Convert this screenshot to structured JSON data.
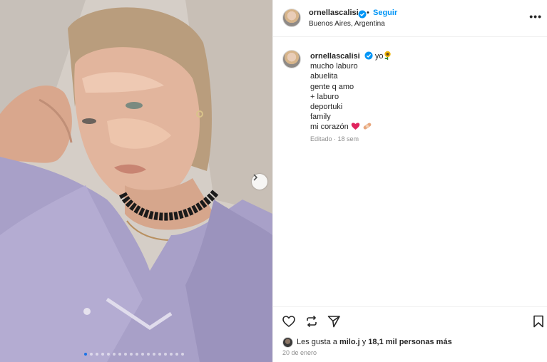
{
  "post": {
    "username": "ornellascalisi",
    "separator": "•",
    "follow_label": "Seguir",
    "location": "Buenos Aires, Argentina",
    "more_icon": "more-horizontal-icon"
  },
  "caption": {
    "username": "ornellascalisi",
    "first_line": "yo",
    "lines": [
      "mucho laburo",
      "abuelita",
      "gente q amo",
      "+ laburo",
      "deportuki",
      "family",
      "mi corazón"
    ],
    "meta": "Editado · 18 sem"
  },
  "actions": {
    "like_icon": "heart-icon",
    "share_icon": "repost-icon",
    "send_icon": "send-icon",
    "save_icon": "bookmark-icon"
  },
  "likes": {
    "prefix": "Les gusta a",
    "user": "milo.j",
    "joiner": "y",
    "others": "18,1 mil personas más"
  },
  "date": "20 de enero",
  "carousel": {
    "count": 18,
    "active_index": 0
  },
  "colors": {
    "accent": "#0095f6",
    "verified": "#0095f6",
    "text": "#262626",
    "muted": "#8e8e8e"
  }
}
